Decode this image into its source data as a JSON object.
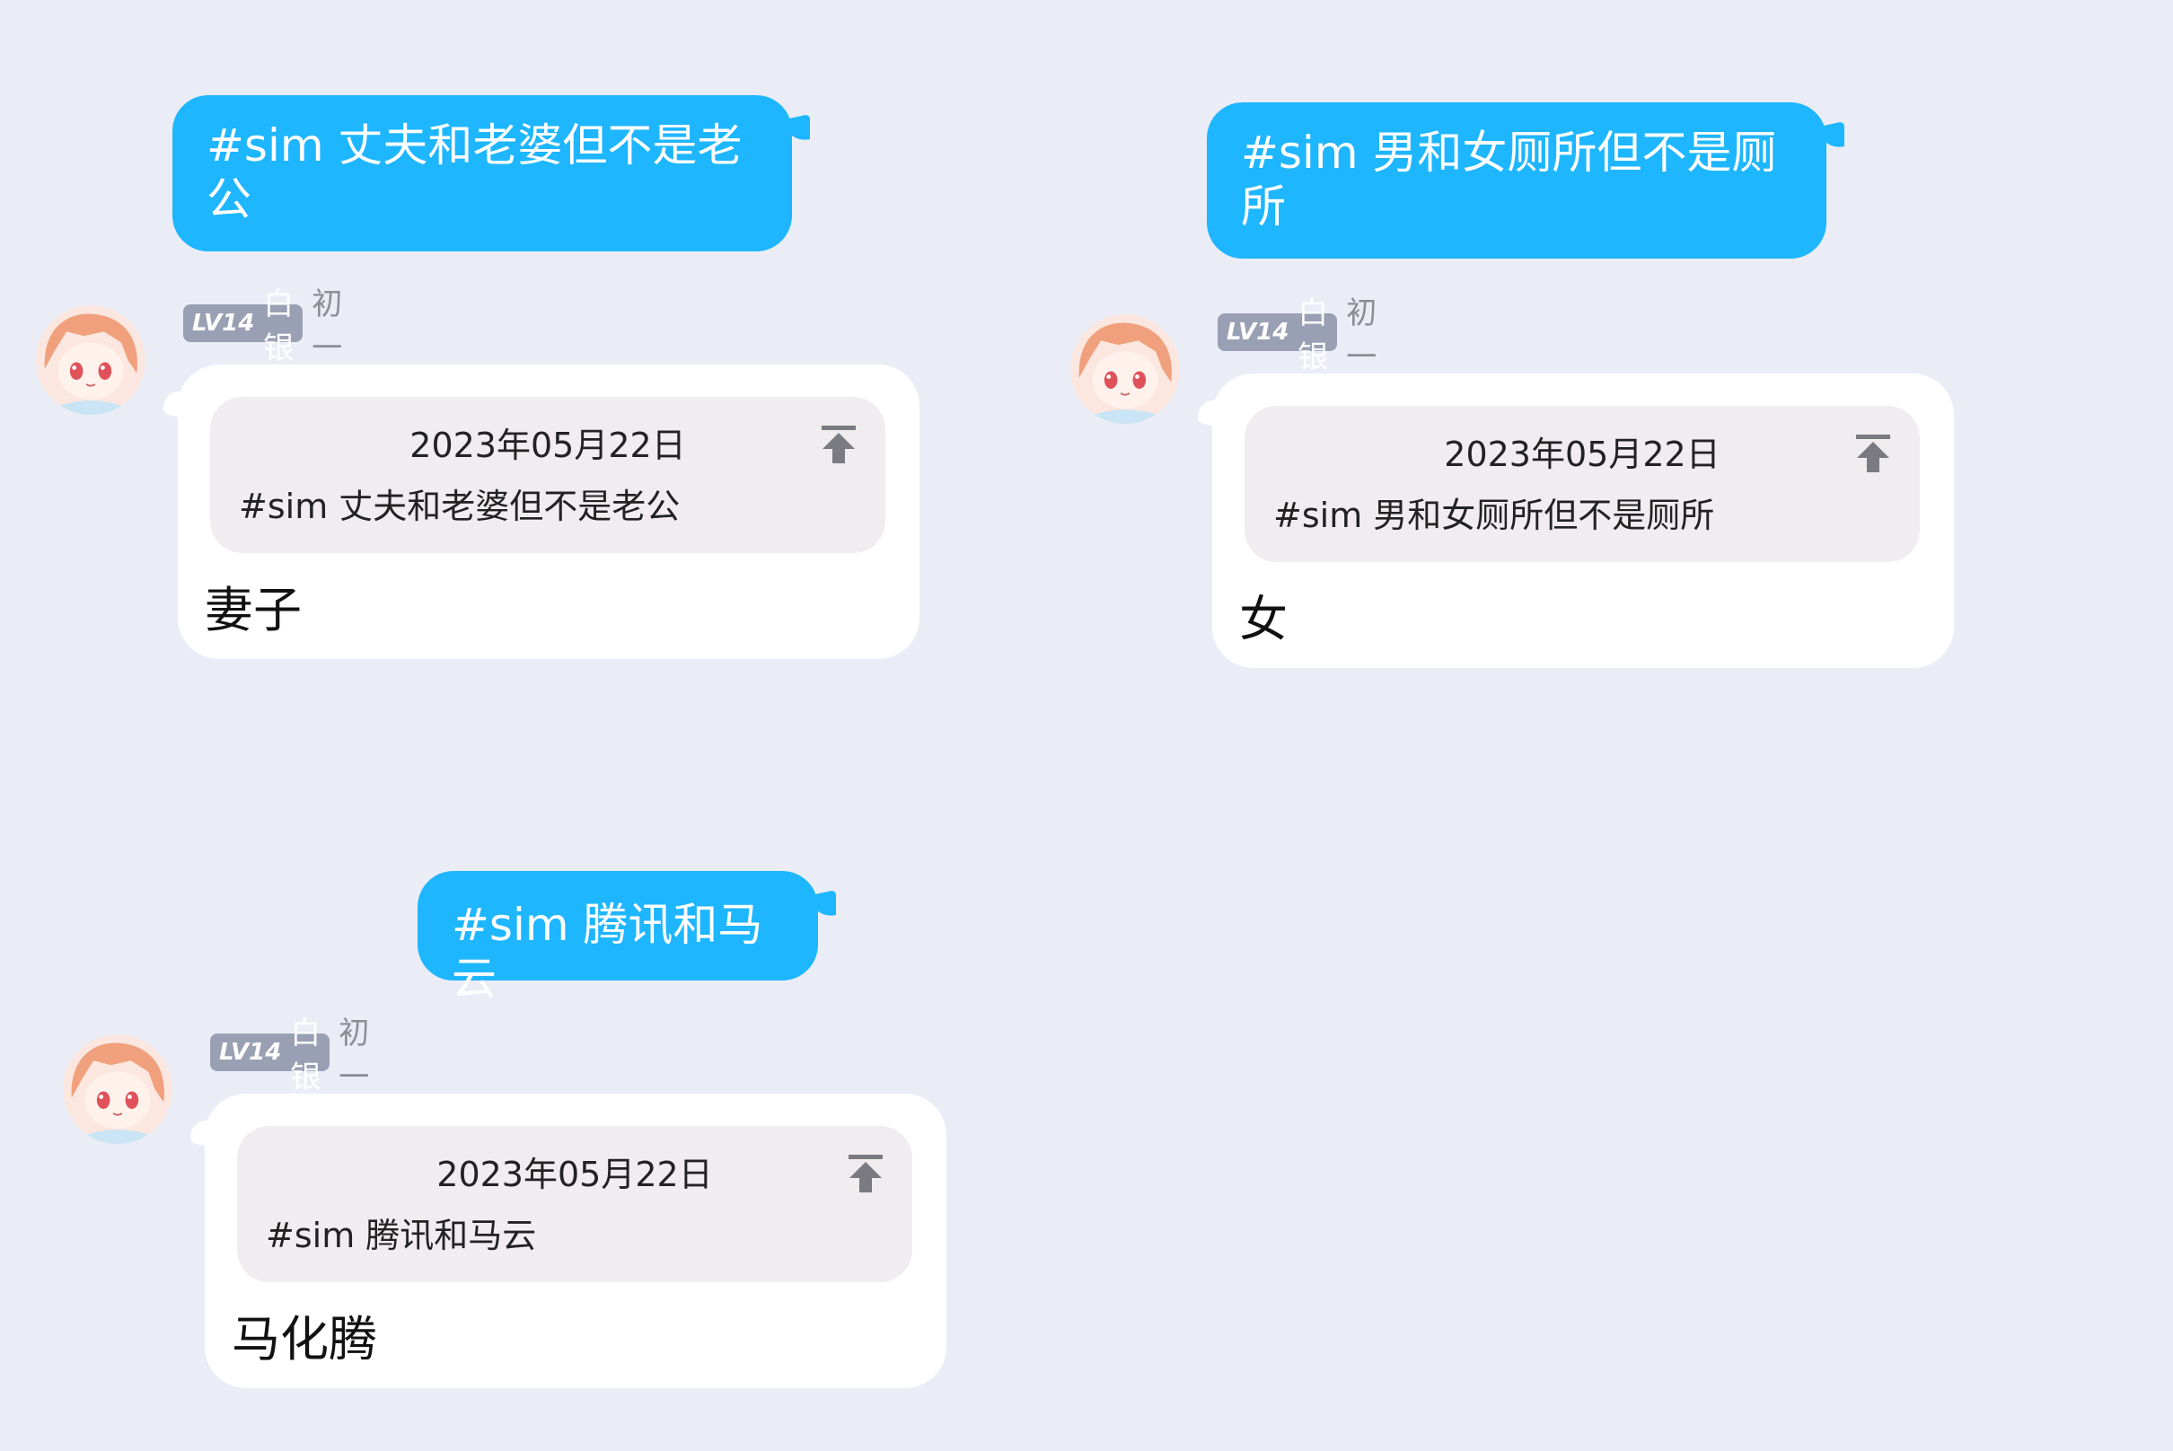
{
  "user": {
    "level": "LV14",
    "rank": "白银",
    "name": "初一"
  },
  "conversations": [
    {
      "sent": "#sim 丈夫和老婆但不是老公",
      "quote_date": "2023年05月22日",
      "quote_text": "#sim 丈夫和老婆但不是老公",
      "answer": "妻子"
    },
    {
      "sent": "#sim 男和女厕所但不是厕所",
      "quote_date": "2023年05月22日",
      "quote_text": "#sim 男和女厕所但不是厕所",
      "answer": "女"
    },
    {
      "sent": "#sim 腾讯和马云",
      "quote_date": "2023年05月22日",
      "quote_text": "#sim 腾讯和马云",
      "answer": "马化腾"
    }
  ],
  "colors": {
    "background": "#eaedf6",
    "sent_bubble": "#1eb6ff",
    "level_badge": "#9aa0b4",
    "quote_bg": "#f0ecef"
  },
  "icons": {
    "avatar": "anime-avatar-icon",
    "jump": "arrow-to-top-icon"
  }
}
